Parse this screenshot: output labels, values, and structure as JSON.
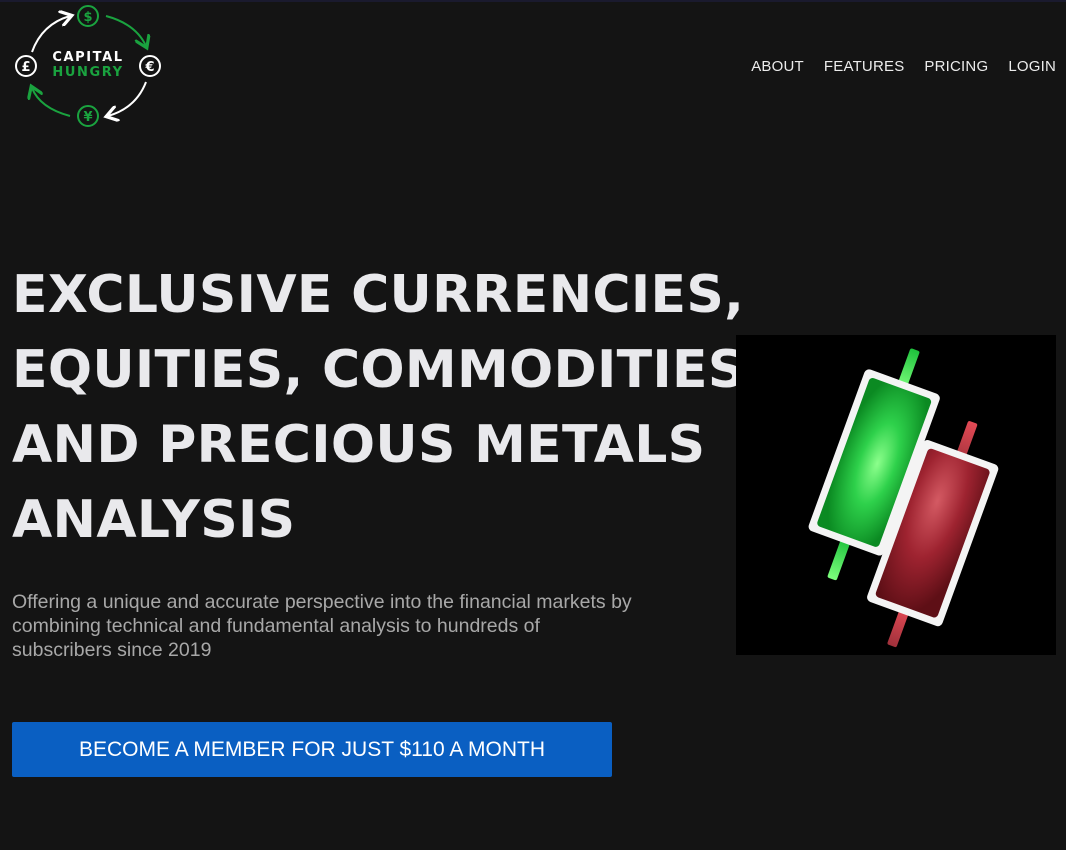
{
  "logo": {
    "line1": "CAPITAL",
    "line2": "HUNGRY",
    "icons": [
      "dollar-icon",
      "euro-icon",
      "yen-icon",
      "pound-icon"
    ],
    "colors": {
      "green": "#1aa33f",
      "white": "#ffffff"
    }
  },
  "nav": {
    "items": [
      {
        "label": "ABOUT"
      },
      {
        "label": "FEATURES"
      },
      {
        "label": "PRICING"
      },
      {
        "label": "LOGIN"
      }
    ]
  },
  "hero": {
    "headline_lines": [
      "EXCLUSIVE CURRENCIES,",
      "EQUITIES, COMMODITIES,",
      "AND PRECIOUS METALS",
      "ANALYSIS"
    ],
    "subtitle_lines": [
      "Offering a unique and accurate perspective into the financial markets by",
      "combining technical and fundamental analysis to hundreds of",
      "subscribers since 2019"
    ],
    "cta_label": "BECOME A MEMBER FOR JUST $110 A MONTH",
    "image": {
      "icon": "candlestick-chart-icon",
      "colors": {
        "bullish": "#1fc23e",
        "bearish": "#9b1c24",
        "background": "#000000"
      }
    }
  },
  "colors": {
    "background": "#141414",
    "accent": "#0a5fc2",
    "headline": "#e9e9ec",
    "subtitle": "#a8a8a8"
  }
}
